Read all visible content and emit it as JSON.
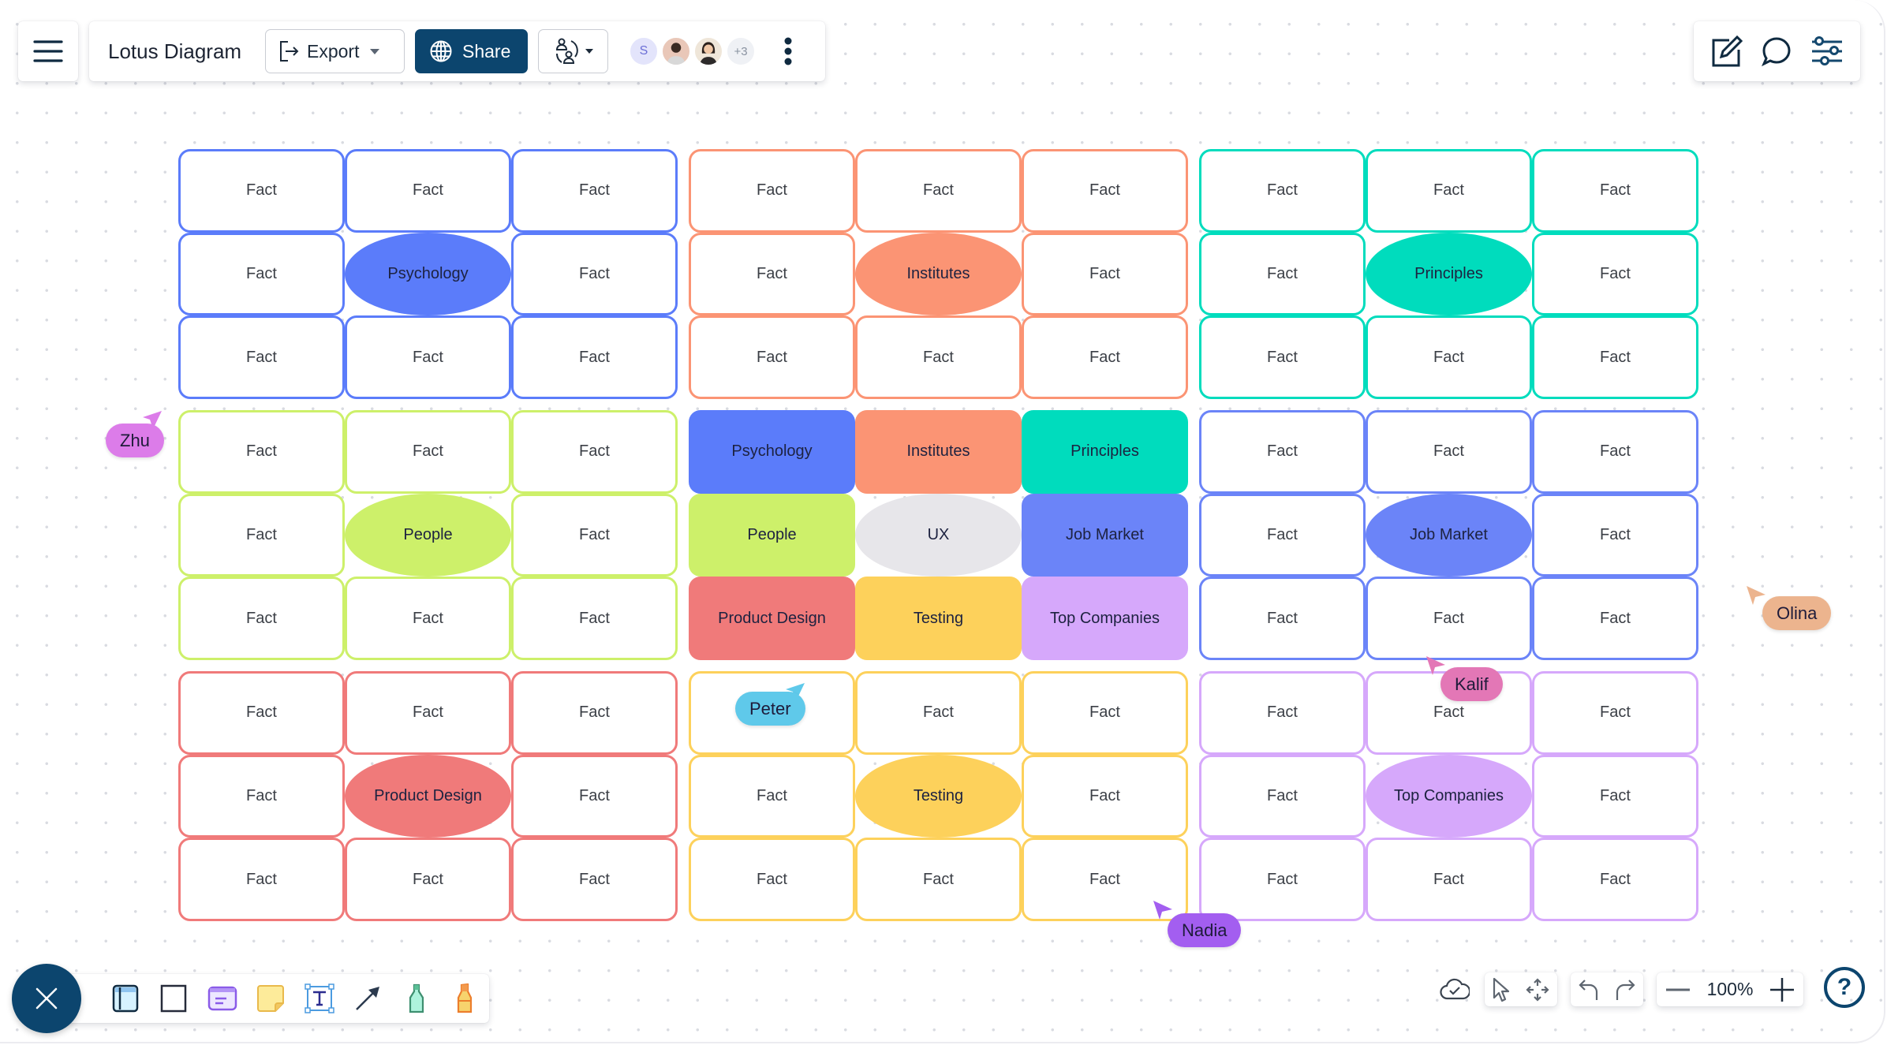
{
  "header": {
    "menu_icon": "hamburger-icon",
    "title": "Lotus Diagram",
    "export_label": "Export",
    "share_label": "Share",
    "avatars": [
      {
        "initial": "S"
      },
      {
        "name": "collaborator-2"
      },
      {
        "name": "collaborator-3"
      },
      {
        "more": "+3"
      }
    ]
  },
  "right_toolbar": {
    "items": [
      "edit-icon",
      "comment-icon",
      "settings-sliders-icon"
    ]
  },
  "bottom_toolbar": {
    "tools": [
      "frame-tool",
      "rectangle-tool",
      "card-tool",
      "sticky-note-tool",
      "text-tool",
      "arrow-tool",
      "marker-tool",
      "highlighter-tool"
    ]
  },
  "zoom": {
    "level": "100%"
  },
  "help_label": "?",
  "colors": {
    "blue": "#5b7cfa",
    "orange": "#fb9474",
    "teal": "#00dcbd",
    "green": "#cdf06a",
    "indigo": "#6b84f8",
    "red": "#f07a7a",
    "yellow": "#fdd15b",
    "purple": "#d6a8fb",
    "gray": "#e7e6ea"
  },
  "lotus": {
    "blocks": [
      {
        "color": "blue",
        "center": "Psychology",
        "cells": [
          "Fact",
          "Fact",
          "Fact",
          "Fact",
          "Psychology",
          "Fact",
          "Fact",
          "Fact",
          "Fact"
        ]
      },
      {
        "color": "orange",
        "center": "Institutes",
        "cells": [
          "Fact",
          "Fact",
          "Fact",
          "Fact",
          "Institutes",
          "Fact",
          "Fact",
          "Fact",
          "Fact"
        ]
      },
      {
        "color": "teal",
        "center": "Principles",
        "cells": [
          "Fact",
          "Fact",
          "Fact",
          "Fact",
          "Principles",
          "Fact",
          "Fact",
          "Fact",
          "Fact"
        ]
      },
      {
        "color": "green",
        "center": "People",
        "cells": [
          "Fact",
          "Fact",
          "Fact",
          "Fact",
          "People",
          "Fact",
          "Fact",
          "Fact",
          "Fact"
        ]
      },
      {
        "color": "core",
        "center": "UX",
        "cells": [
          "Psychology",
          "Institutes",
          "Principles",
          "People",
          "UX",
          "Job Market",
          "Product Design",
          "Testing",
          "Top Companies"
        ],
        "cell_colors": [
          "blue",
          "orange",
          "teal",
          "green",
          "gray",
          "indigo",
          "red",
          "yellow",
          "purple"
        ]
      },
      {
        "color": "indigo",
        "center": "Job Market",
        "cells": [
          "Fact",
          "Fact",
          "Fact",
          "Fact",
          "Job Market",
          "Fact",
          "Fact",
          "Fact",
          "Fact"
        ]
      },
      {
        "color": "red",
        "center": "Product Design",
        "cells": [
          "Fact",
          "Fact",
          "Fact",
          "Fact",
          "Product Design",
          "Fact",
          "Fact",
          "Fact",
          "Fact"
        ]
      },
      {
        "color": "yellow",
        "center": "Testing",
        "cells": [
          "Fact",
          "Fact",
          "Fact",
          "Fact",
          "Testing",
          "Fact",
          "Fact",
          "Fact",
          "Fact"
        ]
      },
      {
        "color": "purple",
        "center": "Top Companies",
        "cells": [
          "Fact",
          "Fact",
          "Fact",
          "Fact",
          "Top Companies",
          "Fact",
          "Fact",
          "Fact",
          "Fact"
        ]
      }
    ]
  },
  "cursors": [
    {
      "name": "Zhu",
      "color": "#dc7ce9"
    },
    {
      "name": "Peter",
      "color": "#5fc9ea"
    },
    {
      "name": "Kalif",
      "color": "#e377b6"
    },
    {
      "name": "Olina",
      "color": "#ecb48e"
    },
    {
      "name": "Nadia",
      "color": "#a35ef0"
    }
  ]
}
